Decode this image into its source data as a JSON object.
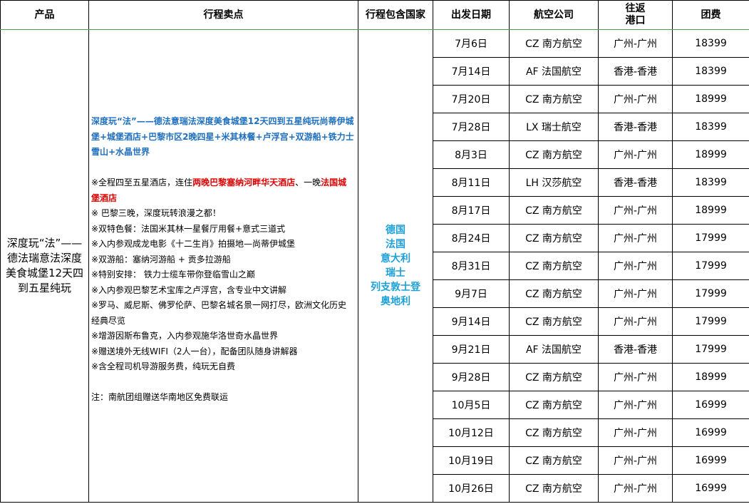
{
  "headers": {
    "product": "产品",
    "highlights": "行程卖点",
    "countries": "行程包含国家",
    "date": "出发日期",
    "airline": "航空公司",
    "port_line1": "往返",
    "port_line2": "港口",
    "price": "团费"
  },
  "product_name": "深度玩“法”——德法瑞意法深度美食城堡12天四到五星纯玩",
  "highlights": {
    "title": "深度玩“法”——德法意瑞法深度美食城堡12天四到五星纯玩尚蒂伊城堡+城堡酒店+巴黎市区2晚四星+米其林餐+卢浮宫+双游船+铁力士雪山+水晶世界",
    "hotel_prefix": "※全程四至五星酒店，连住",
    "hotel_red1": "两晚巴黎塞纳河畔华天酒店",
    "hotel_mid": "、一晚",
    "hotel_red2": "法国城堡酒店",
    "bullets": [
      "※ 巴黎三晚，深度玩转浪漫之都！",
      "※双特色餐：法国米其林一星餐厅用餐+意式三道式",
      "※入内参观成龙电影《十二生肖》拍摄地—尚蒂伊城堡",
      "※双游船：塞纳河游船 + 贡多拉游船",
      "※特别安排：  铁力士缆车带你登临雪山之巅",
      "※入内参观巴黎艺术宝库之卢浮宫，含专业中文讲解",
      "※罗马、威尼斯、佛罗伦萨、巴黎名城名景一网打尽，欧洲文化历史经典尽览",
      "※增游因斯布鲁克，入内参观施华洛世奇水晶世界",
      "※赠送境外无线WIFI（2人一台），配备团队随身讲解器",
      "※含全程司机导游服务费，纯玩无自费"
    ],
    "note": "注：南航团组赠送华南地区免费联运"
  },
  "countries": [
    "德国",
    "法国",
    "意大利",
    "瑞士",
    "列支敦士登",
    "奥地利"
  ],
  "departures": [
    {
      "date": "7月6日",
      "airline": "CZ 南方航空",
      "port": "广州-广州",
      "price": "18399"
    },
    {
      "date": "7月14日",
      "airline": "AF 法国航空",
      "port": "香港-香港",
      "price": "18399"
    },
    {
      "date": "7月20日",
      "airline": "CZ 南方航空",
      "port": "广州-广州",
      "price": "18999"
    },
    {
      "date": "7月28日",
      "airline": "LX 瑞士航空",
      "port": "香港-香港",
      "price": "18399"
    },
    {
      "date": "8月3日",
      "airline": "CZ 南方航空",
      "port": "广州-广州",
      "price": "18999"
    },
    {
      "date": "8月11日",
      "airline": "LH 汉莎航空",
      "port": "香港-香港",
      "price": "18399"
    },
    {
      "date": "8月17日",
      "airline": "CZ 南方航空",
      "port": "广州-广州",
      "price": "18999"
    },
    {
      "date": "8月24日",
      "airline": "CZ 南方航空",
      "port": "广州-广州",
      "price": "17999"
    },
    {
      "date": "8月31日",
      "airline": "CZ 南方航空",
      "port": "广州-广州",
      "price": "17999"
    },
    {
      "date": "9月7日",
      "airline": "CZ 南方航空",
      "port": "广州-广州",
      "price": "17999"
    },
    {
      "date": "9月14日",
      "airline": "CZ 南方航空",
      "port": "广州-广州",
      "price": "17999"
    },
    {
      "date": "9月21日",
      "airline": "AF 法国航空",
      "port": "香港-香港",
      "price": "17999"
    },
    {
      "date": "9月28日",
      "airline": "CZ 南方航空",
      "port": "广州-广州",
      "price": "18999"
    },
    {
      "date": "10月5日",
      "airline": "CZ 南方航空",
      "port": "广州-广州",
      "price": "16999"
    },
    {
      "date": "10月12日",
      "airline": "CZ 南方航空",
      "port": "广州-广州",
      "price": "16999"
    },
    {
      "date": "10月19日",
      "airline": "CZ 南方航空",
      "port": "广州-广州",
      "price": "16999"
    },
    {
      "date": "10月26日",
      "airline": "CZ 南方航空",
      "port": "广州-广州",
      "price": "16999"
    }
  ]
}
